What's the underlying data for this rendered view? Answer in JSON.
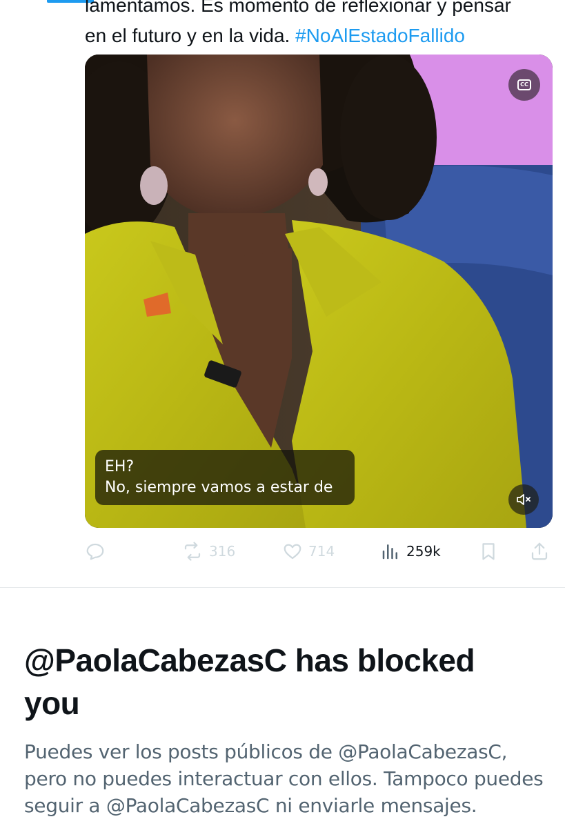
{
  "tweet": {
    "text_line1": "lamentamos. Es momento de reflexionar y pensar",
    "text_line2_plain": "en el futuro y en la vida.",
    "hashtag": "#NoAlEstadoFallido"
  },
  "video": {
    "captions_icon": "closed-captions-icon",
    "caption_line1": "EH?",
    "caption_line2": "No, siempre vamos a estar de",
    "mute_icon": "volume-muted-icon"
  },
  "actions": {
    "reply_icon": "reply-icon",
    "retweet_icon": "retweet-icon",
    "retweet_count": "316",
    "like_icon": "heart-icon",
    "like_count": "714",
    "views_icon": "views-bar-chart-icon",
    "views_count": "259k",
    "bookmark_icon": "bookmark-icon",
    "share_icon": "share-icon"
  },
  "blocked": {
    "title_line1": "@PaolaCabezasC has blocked",
    "title_line2": "you",
    "desc_line1": "Puedes ver los posts públicos de @PaolaCabezasC,",
    "desc_line2": "pero no puedes interactuar con ellos. Tampoco puedes",
    "desc_line3": "seguir a @PaolaCabezasC ni enviarle mensajes."
  },
  "colors": {
    "accent": "#1d9bf0",
    "text_primary": "#0f1419",
    "text_secondary": "#536471",
    "icon_faded": "#cfd9de"
  }
}
